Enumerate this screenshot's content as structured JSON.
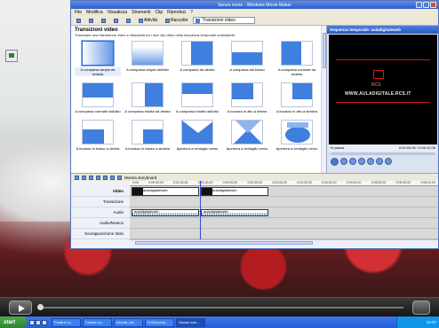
{
  "window": {
    "title": "Senza nome - Windows Movie Maker"
  },
  "menu": [
    "File",
    "Modifica",
    "Visualizza",
    "Strumenti",
    "Clip",
    "Riproduci",
    "?"
  ],
  "toolbar": {
    "tasks_label": "Attività",
    "collections_label": "Raccolte",
    "selector_value": "Transizioni video"
  },
  "left_pane": {
    "title": "Transizioni video",
    "description": "Trascinare una transizione video e rilasciarla tra i due clip video nella sequenza temporale sottostante.",
    "tiles": [
      "A comparsa ampia da sinistra",
      "A comparsa ampia dall'alto",
      "A comparsa da destra",
      "A comparsa dal basso",
      "A comparsa normale da sinistra",
      "A comparsa normale dall'alto",
      "A comparsa ridotta da destra",
      "A comparsa ridotta dall'alto",
      "A incasso in alto a destra",
      "A incasso in alto a sinistra",
      "A incasso in basso a destra",
      "A incasso in basso a sinistra",
      "Apertura a ventaglio verso",
      "Apertura a ventaglio verso",
      "Apertura a ventaglio verso"
    ]
  },
  "preview": {
    "title": "Sequenza temporale: auladigitaleweb",
    "brand": "RCS",
    "url": "WWW.AULADIGITALE.RCS.IT",
    "status": "In pausa",
    "time": "0:04:05,36 / 0:06:12,06"
  },
  "storyboard": {
    "toggle_label": "Mostra storyboard",
    "ruler": [
      "0:00",
      "0:00:30,00",
      "0:01:00,00",
      "0:01:30,00",
      "0:02:00,00",
      "0:02:30,00",
      "0:03:00,00",
      "0:03:30,00",
      "0:04:00,00",
      "0:04:30,00",
      "0:05:00,00",
      "0:05:30,00",
      "0:06:00,00"
    ],
    "tracks": [
      "Video",
      "Transizione",
      "Audio",
      "Audio/Musica",
      "Sovrapposizione titolo"
    ],
    "video_clips": [
      "auladigitaleweb",
      "auladigitaleweb"
    ],
    "audio_clips": [
      "auladigitaleweb",
      "auladigitaleweb"
    ]
  },
  "taskbar": {
    "start": "start",
    "tasks": [
      "Posta in a...",
      "Creare un...",
      "tutorial_vid...",
      "D:\\Docume...",
      "Senza nom..."
    ],
    "clock": "16:07"
  },
  "colors": {
    "accent": "#3f7fde",
    "titlebar": "#2b5bc9",
    "taskbar": "#245edb"
  }
}
